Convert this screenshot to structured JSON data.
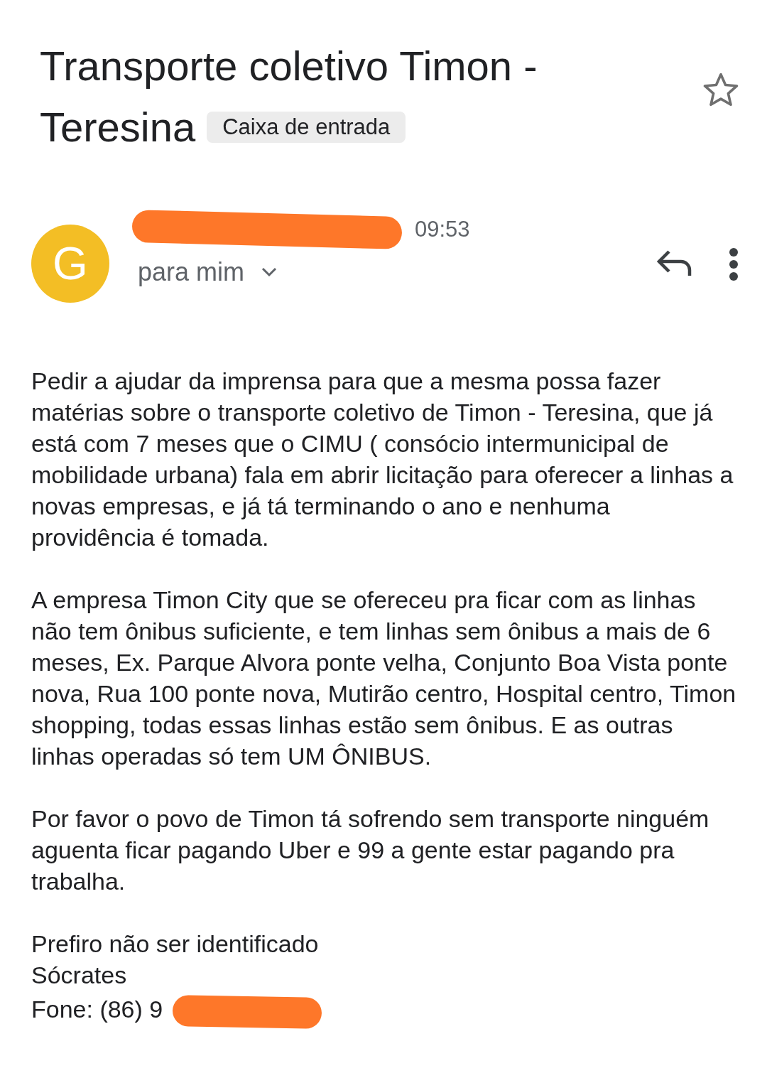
{
  "email": {
    "subject": "Transporte coletivo Timon - Teresina",
    "label": "Caixa de entrada",
    "starred": false,
    "sender": {
      "avatar_letter": "G",
      "time": "09:53",
      "recipient": "para mim"
    },
    "body": [
      "Pedir a ajudar da imprensa para que a mesma possa fazer matérias sobre o transporte coletivo de Timon - Teresina, que já está com 7 meses que o CIMU ( consócio intermunicipal de mobilidade urbana) fala em abrir licitação para oferecer a linhas a novas empresas, e já tá terminando o ano e nenhuma providência é tomada.",
      "A empresa Timon City que se ofereceu pra ficar com as linhas não tem ônibus suficiente, e tem linhas sem ônibus a mais de 6 meses, Ex. Parque Alvora ponte velha, Conjunto Boa Vista ponte nova, Rua 100 ponte nova, Mutirão centro, Hospital centro, Timon shopping, todas essas linhas estão sem ônibus. E as outras linhas operadas só tem UM ÔNIBUS.",
      "Por favor o povo de Timon tá sofrendo sem transporte ninguém aguenta ficar pagando Uber e 99 a gente estar pagando pra trabalha."
    ],
    "signature": [
      "Prefiro não ser identificado",
      "Sócrates",
      "Fone: (86) 9"
    ]
  }
}
